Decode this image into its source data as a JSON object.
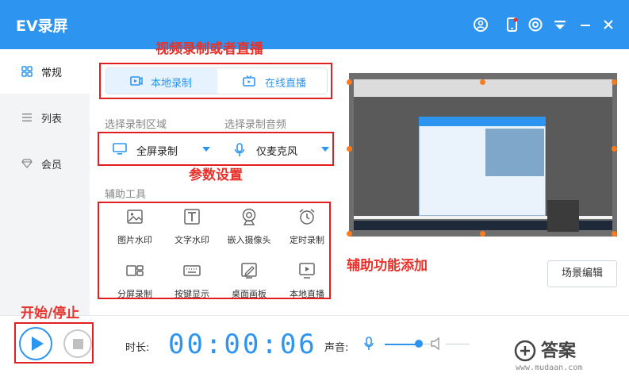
{
  "app": {
    "title": "EV录屏"
  },
  "sidebar": {
    "items": [
      {
        "label": "常规",
        "icon": "grid-icon",
        "active": true
      },
      {
        "label": "列表",
        "icon": "list-icon",
        "active": false
      },
      {
        "label": "会员",
        "icon": "diamond-icon",
        "active": false
      }
    ]
  },
  "mode_tabs": [
    {
      "label": "本地录制",
      "icon": "record-icon",
      "active": true
    },
    {
      "label": "在线直播",
      "icon": "live-tv-icon",
      "active": false
    }
  ],
  "record_area": {
    "label": "选择录制区域",
    "value": "全屏录制"
  },
  "record_audio": {
    "label": "选择录制音频",
    "value": "仅麦克风"
  },
  "tools": {
    "label": "辅助工具",
    "items": [
      {
        "label": "图片水印",
        "icon": "image-icon"
      },
      {
        "label": "文字水印",
        "icon": "text-icon"
      },
      {
        "label": "嵌入摄像头",
        "icon": "camera-icon"
      },
      {
        "label": "定时录制",
        "icon": "alarm-icon"
      },
      {
        "label": "分屏录制",
        "icon": "split-screen-icon"
      },
      {
        "label": "按键显示",
        "icon": "keyboard-icon"
      },
      {
        "label": "桌面画板",
        "icon": "pen-board-icon"
      },
      {
        "label": "本地直播",
        "icon": "play-screen-icon"
      }
    ]
  },
  "scene_button": "场景编辑",
  "bottom": {
    "duration_label": "时长:",
    "timer": "00:00:06",
    "sound_label": "声音:",
    "volume_level": 0.7
  },
  "annotations": {
    "mode": "视频录制或者直播",
    "params": "参数设置",
    "tools": "辅助功能添加",
    "start_stop": "开始/停止"
  },
  "watermark": {
    "brand": "答案",
    "site": "www.mudaan.com"
  },
  "colors": {
    "accent": "#2d95f0",
    "annotation": "#e02020"
  }
}
